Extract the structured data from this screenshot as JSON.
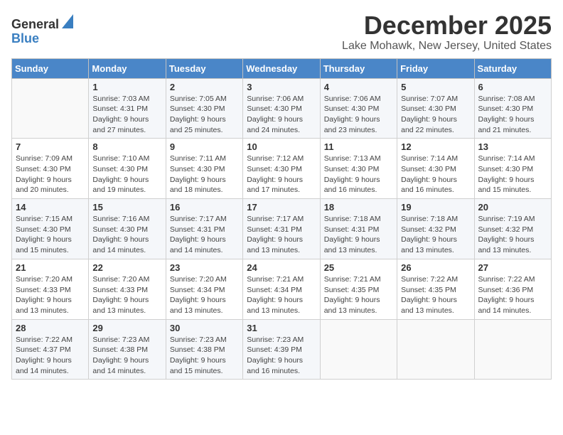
{
  "logo": {
    "general": "General",
    "blue": "Blue"
  },
  "title": {
    "month": "December 2025",
    "location": "Lake Mohawk, New Jersey, United States"
  },
  "weekdays": [
    "Sunday",
    "Monday",
    "Tuesday",
    "Wednesday",
    "Thursday",
    "Friday",
    "Saturday"
  ],
  "weeks": [
    [
      {
        "day": "",
        "info": ""
      },
      {
        "day": "1",
        "info": "Sunrise: 7:03 AM\nSunset: 4:31 PM\nDaylight: 9 hours\nand 27 minutes."
      },
      {
        "day": "2",
        "info": "Sunrise: 7:05 AM\nSunset: 4:30 PM\nDaylight: 9 hours\nand 25 minutes."
      },
      {
        "day": "3",
        "info": "Sunrise: 7:06 AM\nSunset: 4:30 PM\nDaylight: 9 hours\nand 24 minutes."
      },
      {
        "day": "4",
        "info": "Sunrise: 7:06 AM\nSunset: 4:30 PM\nDaylight: 9 hours\nand 23 minutes."
      },
      {
        "day": "5",
        "info": "Sunrise: 7:07 AM\nSunset: 4:30 PM\nDaylight: 9 hours\nand 22 minutes."
      },
      {
        "day": "6",
        "info": "Sunrise: 7:08 AM\nSunset: 4:30 PM\nDaylight: 9 hours\nand 21 minutes."
      }
    ],
    [
      {
        "day": "7",
        "info": "Sunrise: 7:09 AM\nSunset: 4:30 PM\nDaylight: 9 hours\nand 20 minutes."
      },
      {
        "day": "8",
        "info": "Sunrise: 7:10 AM\nSunset: 4:30 PM\nDaylight: 9 hours\nand 19 minutes."
      },
      {
        "day": "9",
        "info": "Sunrise: 7:11 AM\nSunset: 4:30 PM\nDaylight: 9 hours\nand 18 minutes."
      },
      {
        "day": "10",
        "info": "Sunrise: 7:12 AM\nSunset: 4:30 PM\nDaylight: 9 hours\nand 17 minutes."
      },
      {
        "day": "11",
        "info": "Sunrise: 7:13 AM\nSunset: 4:30 PM\nDaylight: 9 hours\nand 16 minutes."
      },
      {
        "day": "12",
        "info": "Sunrise: 7:14 AM\nSunset: 4:30 PM\nDaylight: 9 hours\nand 16 minutes."
      },
      {
        "day": "13",
        "info": "Sunrise: 7:14 AM\nSunset: 4:30 PM\nDaylight: 9 hours\nand 15 minutes."
      }
    ],
    [
      {
        "day": "14",
        "info": "Sunrise: 7:15 AM\nSunset: 4:30 PM\nDaylight: 9 hours\nand 15 minutes."
      },
      {
        "day": "15",
        "info": "Sunrise: 7:16 AM\nSunset: 4:30 PM\nDaylight: 9 hours\nand 14 minutes."
      },
      {
        "day": "16",
        "info": "Sunrise: 7:17 AM\nSunset: 4:31 PM\nDaylight: 9 hours\nand 14 minutes."
      },
      {
        "day": "17",
        "info": "Sunrise: 7:17 AM\nSunset: 4:31 PM\nDaylight: 9 hours\nand 13 minutes."
      },
      {
        "day": "18",
        "info": "Sunrise: 7:18 AM\nSunset: 4:31 PM\nDaylight: 9 hours\nand 13 minutes."
      },
      {
        "day": "19",
        "info": "Sunrise: 7:18 AM\nSunset: 4:32 PM\nDaylight: 9 hours\nand 13 minutes."
      },
      {
        "day": "20",
        "info": "Sunrise: 7:19 AM\nSunset: 4:32 PM\nDaylight: 9 hours\nand 13 minutes."
      }
    ],
    [
      {
        "day": "21",
        "info": "Sunrise: 7:20 AM\nSunset: 4:33 PM\nDaylight: 9 hours\nand 13 minutes."
      },
      {
        "day": "22",
        "info": "Sunrise: 7:20 AM\nSunset: 4:33 PM\nDaylight: 9 hours\nand 13 minutes."
      },
      {
        "day": "23",
        "info": "Sunrise: 7:20 AM\nSunset: 4:34 PM\nDaylight: 9 hours\nand 13 minutes."
      },
      {
        "day": "24",
        "info": "Sunrise: 7:21 AM\nSunset: 4:34 PM\nDaylight: 9 hours\nand 13 minutes."
      },
      {
        "day": "25",
        "info": "Sunrise: 7:21 AM\nSunset: 4:35 PM\nDaylight: 9 hours\nand 13 minutes."
      },
      {
        "day": "26",
        "info": "Sunrise: 7:22 AM\nSunset: 4:35 PM\nDaylight: 9 hours\nand 13 minutes."
      },
      {
        "day": "27",
        "info": "Sunrise: 7:22 AM\nSunset: 4:36 PM\nDaylight: 9 hours\nand 14 minutes."
      }
    ],
    [
      {
        "day": "28",
        "info": "Sunrise: 7:22 AM\nSunset: 4:37 PM\nDaylight: 9 hours\nand 14 minutes."
      },
      {
        "day": "29",
        "info": "Sunrise: 7:23 AM\nSunset: 4:38 PM\nDaylight: 9 hours\nand 14 minutes."
      },
      {
        "day": "30",
        "info": "Sunrise: 7:23 AM\nSunset: 4:38 PM\nDaylight: 9 hours\nand 15 minutes."
      },
      {
        "day": "31",
        "info": "Sunrise: 7:23 AM\nSunset: 4:39 PM\nDaylight: 9 hours\nand 16 minutes."
      },
      {
        "day": "",
        "info": ""
      },
      {
        "day": "",
        "info": ""
      },
      {
        "day": "",
        "info": ""
      }
    ]
  ]
}
